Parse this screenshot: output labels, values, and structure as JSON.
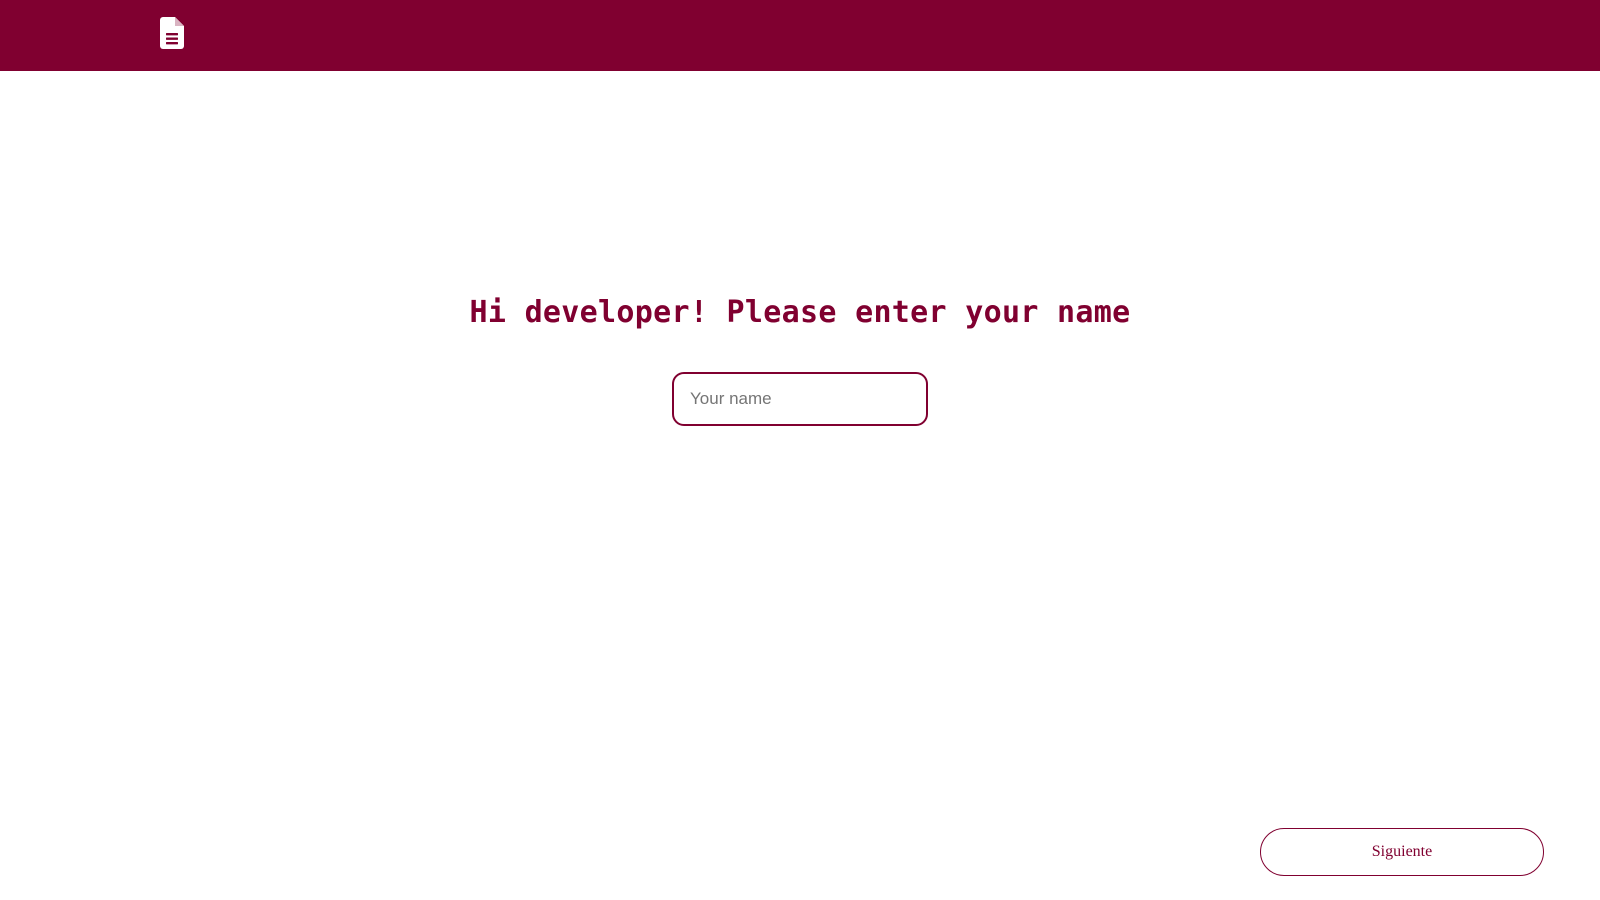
{
  "header": {
    "icon": "document-icon",
    "background_color": "#800030",
    "icon_color": "#ffffff"
  },
  "main": {
    "heading": "Hi developer! Please enter your name",
    "name_input": {
      "value": "",
      "placeholder": "Your name"
    },
    "next_button_label": "Siguiente"
  },
  "colors": {
    "accent": "#800030",
    "background": "#ffffff"
  }
}
